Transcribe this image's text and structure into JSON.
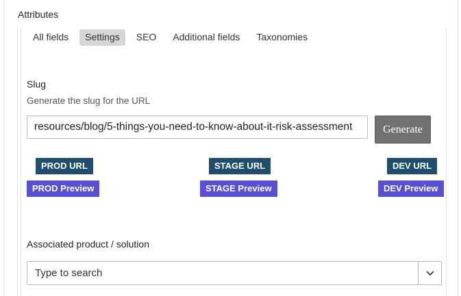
{
  "section": {
    "title": "Attributes"
  },
  "tabs": [
    {
      "label": "All fields",
      "active": false
    },
    {
      "label": "Settings",
      "active": true
    },
    {
      "label": "SEO",
      "active": false
    },
    {
      "label": "Additional fields",
      "active": false
    },
    {
      "label": "Taxonomies",
      "active": false
    }
  ],
  "slug": {
    "label": "Slug",
    "help": "Generate the slug for the URL",
    "value": "resources/blog/5-things-you-need-to-know-about-it-risk-assessment",
    "generate_label": "Generate"
  },
  "links": {
    "prod_url": "PROD URL",
    "stage_url": "STAGE URL",
    "dev_url": "DEV URL",
    "prod_preview": "PROD Preview",
    "stage_preview": "STAGE Preview",
    "dev_preview": "DEV Preview"
  },
  "associated": {
    "label": "Associated product / solution",
    "placeholder": "Type to search",
    "icon": "chevron-down-icon"
  },
  "colors": {
    "url_badge": "#1f4e6f",
    "preview_badge": "#5850d6",
    "generate_button": "#717171",
    "active_tab": "#d6d6d6"
  }
}
